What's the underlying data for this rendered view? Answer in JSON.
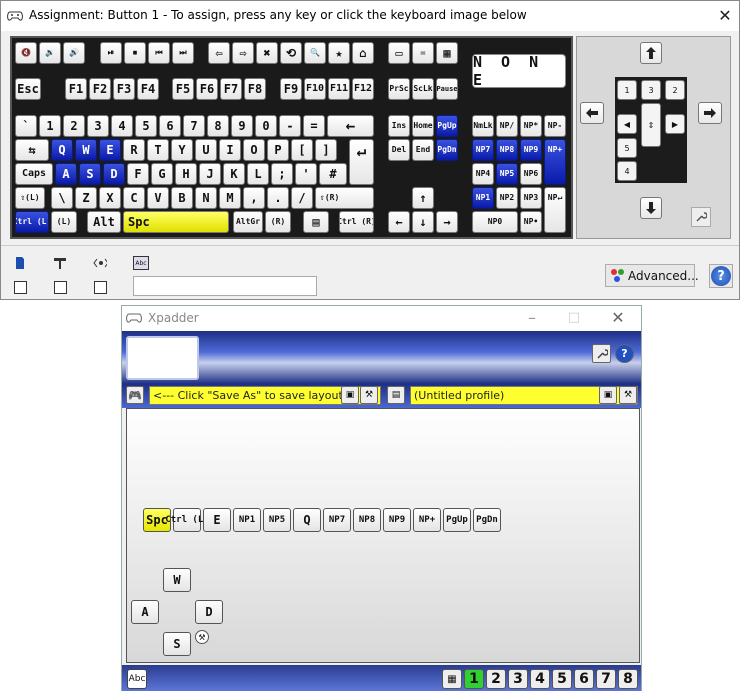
{
  "assign_dialog": {
    "title": "Assignment: Button 1 - To assign, press any key or click the keyboard image below",
    "close": "✕",
    "none_label": "N O N E",
    "advanced_label": "Advanced...",
    "help_label": "?",
    "text_value": "",
    "keys": {
      "esc": "Esc",
      "f1": "F1",
      "f2": "F2",
      "f3": "F3",
      "f4": "F4",
      "f5": "F5",
      "f6": "F6",
      "f7": "F7",
      "f8": "F8",
      "f9": "F9",
      "f10": "F10",
      "f11": "F11",
      "f12": "F12",
      "prtsc": "PrSc",
      "sclk": "ScLk",
      "pause": "Pause",
      "tilde": "`",
      "n1": "1",
      "n2": "2",
      "n3": "3",
      "n4": "4",
      "n5": "5",
      "n6": "6",
      "n7": "7",
      "n8": "8",
      "n9": "9",
      "n0": "0",
      "minus": "-",
      "equals": "=",
      "backspace": "←",
      "tab": "⇆",
      "q": "Q",
      "w": "W",
      "e": "E",
      "r": "R",
      "t": "T",
      "y": "Y",
      "u": "U",
      "i": "I",
      "o": "O",
      "p": "P",
      "lbr": "[",
      "rbr": "]",
      "enter": "↵",
      "caps": "Caps",
      "a": "A",
      "s": "S",
      "d": "D",
      "f": "F",
      "g": "G",
      "h": "H",
      "j": "J",
      "k": "K",
      "l": "L",
      "semi": ";",
      "quote": "'",
      "hash": "#",
      "lshift": "⇧(L)",
      "bslash": "\\",
      "z": "Z",
      "x": "X",
      "c": "C",
      "v": "V",
      "b": "B",
      "n": "N",
      "m": "M",
      "comma": ",",
      "period": ".",
      "slash": "/",
      "rshift": "⇧(R)",
      "lctrl": "Ctrl (L)",
      "lwin": "(L)",
      "alt": "Alt",
      "spc": "Spc",
      "altgr": "AltGr",
      "rwin": "(R)",
      "menu": "▤",
      "rctrl": "Ctrl (R)",
      "ins": "Ins",
      "home": "Home",
      "pgup": "PgUp",
      "del": "Del",
      "end": "End",
      "pgdn": "PgDn",
      "up": "↑",
      "left": "←",
      "down": "↓",
      "right": "→",
      "numlk": "NmLk",
      "npdiv": "NP/",
      "npmul": "NP*",
      "npsub": "NP-",
      "np7": "NP7",
      "np8": "NP8",
      "np9": "NP9",
      "npadd": "NP+",
      "np4": "NP4",
      "np5": "NP5",
      "np6": "NP6",
      "np1": "NP1",
      "np2": "NP2",
      "np3": "NP3",
      "npenter": "NP↵",
      "np0": "NP0",
      "npdot": "NP•"
    },
    "media": [
      "🔇",
      "🔉",
      "🔊",
      "⏯",
      "⏹",
      "⏮",
      "⏭",
      "⇦",
      "⇨",
      "✖",
      "⟲",
      "🔍",
      "★",
      "⌂",
      "▭",
      "✉",
      "▦"
    ]
  },
  "xpadder": {
    "title": "Xpadder",
    "layout_hint": "<--- Click \"Save As\" to save layout",
    "profile": "(Untitled profile)",
    "buttons": [
      "Spc",
      "Ctrl (L)",
      "E",
      "NP1",
      "NP5",
      "Q",
      "NP7",
      "NP8",
      "NP9",
      "NP+",
      "PgUp",
      "PgDn"
    ],
    "wasd": {
      "w": "W",
      "a": "A",
      "s": "S",
      "d": "D"
    },
    "abc": "Abc",
    "sets": [
      "1",
      "2",
      "3",
      "4",
      "5",
      "6",
      "7",
      "8"
    ]
  },
  "colors": {
    "accent_blue": "#0a1aa8",
    "highlight_yellow": "#ffff30",
    "set_selected": "#2fd02f"
  }
}
